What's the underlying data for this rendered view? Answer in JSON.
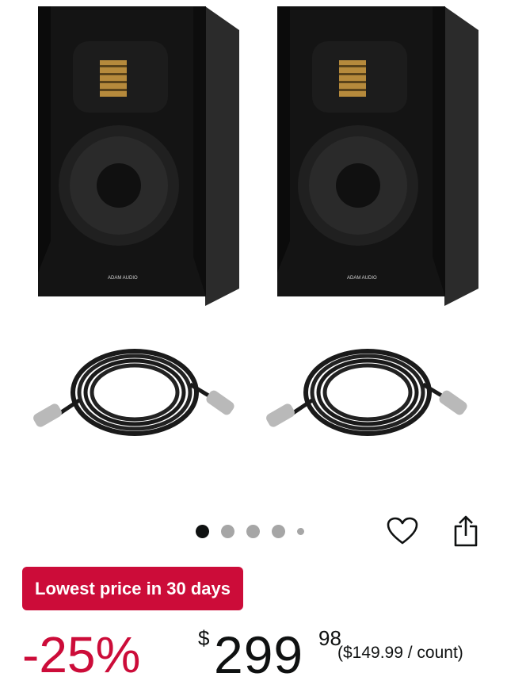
{
  "product": {
    "images": [
      {
        "name": "adam-audio-speaker",
        "brand_text": "ADAM AUDIO"
      },
      {
        "name": "adam-audio-speaker",
        "brand_text": "ADAM AUDIO"
      },
      {
        "name": "xlr-cable"
      },
      {
        "name": "xlr-cable"
      }
    ],
    "carousel": {
      "total_dots": 5,
      "active_index": 0
    }
  },
  "actions": {
    "wishlist_icon": "heart-icon",
    "share_icon": "share-icon"
  },
  "deal": {
    "badge_label": "Lowest price in 30 days",
    "badge_color": "#cc0c39"
  },
  "price": {
    "discount": "-25%",
    "currency_symbol": "$",
    "whole": "299",
    "fraction": "98",
    "unit_price": "($149.99 / count)"
  }
}
